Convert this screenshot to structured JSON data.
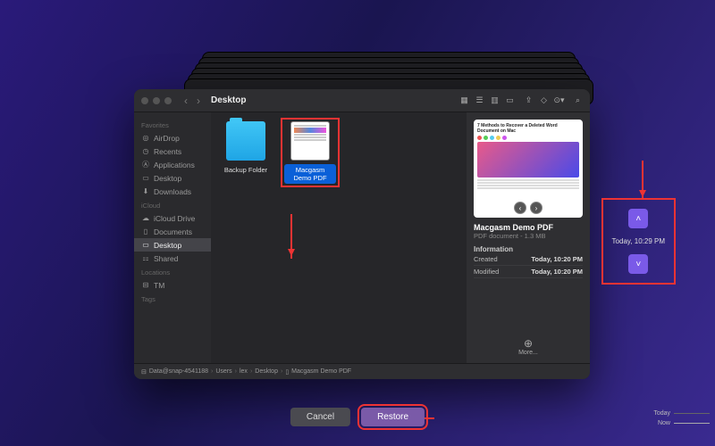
{
  "window": {
    "title": "Desktop"
  },
  "sidebar": {
    "groups": [
      {
        "label": "Favorites",
        "items": [
          {
            "icon": "airdrop-icon",
            "label": "AirDrop"
          },
          {
            "icon": "clock-icon",
            "label": "Recents"
          },
          {
            "icon": "apps-icon",
            "label": "Applications"
          },
          {
            "icon": "desktop-icon",
            "label": "Desktop"
          },
          {
            "icon": "downloads-icon",
            "label": "Downloads"
          }
        ]
      },
      {
        "label": "iCloud",
        "items": [
          {
            "icon": "cloud-icon",
            "label": "iCloud Drive"
          },
          {
            "icon": "doc-icon",
            "label": "Documents"
          },
          {
            "icon": "desktop-icon",
            "label": "Desktop",
            "selected": true
          },
          {
            "icon": "shared-icon",
            "label": "Shared"
          }
        ]
      },
      {
        "label": "Locations",
        "items": [
          {
            "icon": "disk-icon",
            "label": "TM"
          }
        ]
      },
      {
        "label": "Tags",
        "items": []
      }
    ]
  },
  "files": [
    {
      "name": "Backup Folder",
      "type": "folder"
    },
    {
      "name": "Macgasm Demo PDF",
      "type": "pdf",
      "selected": true
    }
  ],
  "preview": {
    "thumb_header": "7 Methods to Recover a Deleted Word Document on Mac",
    "title": "Macgasm Demo PDF",
    "subtitle": "PDF document - 1.3 MB",
    "info_label": "Information",
    "rows": [
      {
        "k": "Created",
        "v": "Today, 10:20 PM"
      },
      {
        "k": "Modified",
        "v": "Today, 10:20 PM"
      }
    ],
    "more": "More..."
  },
  "path": [
    "Data@snap-4541188",
    "Users",
    "lex",
    "Desktop",
    "Macgasm Demo PDF"
  ],
  "buttons": {
    "cancel": "Cancel",
    "restore": "Restore"
  },
  "tm": {
    "label": "Today, 10:29 PM"
  },
  "timeline": {
    "today": "Today",
    "now": "Now"
  }
}
